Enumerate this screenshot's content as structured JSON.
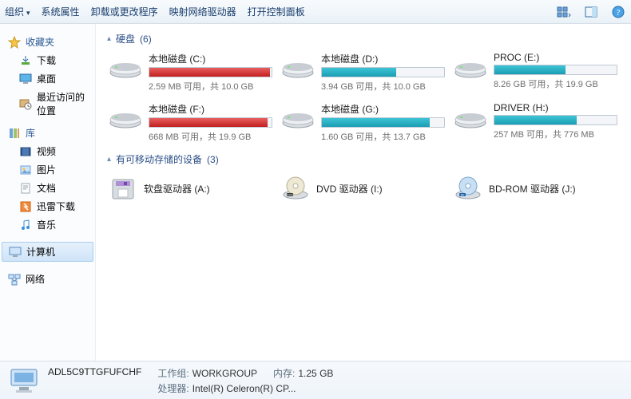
{
  "toolbar": {
    "organize": "组织",
    "system_props": "系统属性",
    "uninstall": "卸载或更改程序",
    "map_drive": "映射网络驱动器",
    "control_panel": "打开控制面板"
  },
  "sidebar": {
    "favorites": {
      "label": "收藏夹",
      "items": [
        "下载",
        "桌面",
        "最近访问的位置"
      ]
    },
    "libraries": {
      "label": "库",
      "items": [
        "视频",
        "图片",
        "文档",
        "迅雷下载",
        "音乐"
      ]
    },
    "computer": "计算机",
    "network": "网络"
  },
  "groups": {
    "hdd_label": "硬盘",
    "hdd_count": "(6)",
    "removable_label": "有可移动存储的设备",
    "removable_count": "(3)"
  },
  "drives": [
    {
      "name": "本地磁盘 (C:)",
      "free": "2.59 MB 可用，共 10.0 GB",
      "pct": 99,
      "tone": "red"
    },
    {
      "name": "本地磁盘 (D:)",
      "free": "3.94 GB 可用，共 10.0 GB",
      "pct": 61,
      "tone": "teal"
    },
    {
      "name": "PROC (E:)",
      "free": "8.26 GB 可用，共 19.9 GB",
      "pct": 58,
      "tone": "teal"
    },
    {
      "name": "本地磁盘 (F:)",
      "free": "668 MB 可用，共 19.9 GB",
      "pct": 97,
      "tone": "red"
    },
    {
      "name": "本地磁盘 (G:)",
      "free": "1.60 GB 可用，共 13.7 GB",
      "pct": 88,
      "tone": "teal"
    },
    {
      "name": "DRIVER (H:)",
      "free": "257 MB 可用，共 776 MB",
      "pct": 67,
      "tone": "teal"
    }
  ],
  "removables": [
    {
      "name": "软盘驱动器 (A:)",
      "kind": "floppy"
    },
    {
      "name": "DVD 驱动器 (I:)",
      "kind": "dvd"
    },
    {
      "name": "BD-ROM 驱动器 (J:)",
      "kind": "bd"
    }
  ],
  "status": {
    "computer_name": "ADL5C9TTGFUFCHF",
    "workgroup_label": "工作组:",
    "workgroup": "WORKGROUP",
    "memory_label": "内存:",
    "memory": "1.25 GB",
    "processor_label": "处理器:",
    "processor": "Intel(R) Celeron(R) CP..."
  },
  "colors": {
    "accent": "#2b4f88",
    "bar_red": "#c21f1f",
    "bar_teal": "#1a9db3"
  }
}
